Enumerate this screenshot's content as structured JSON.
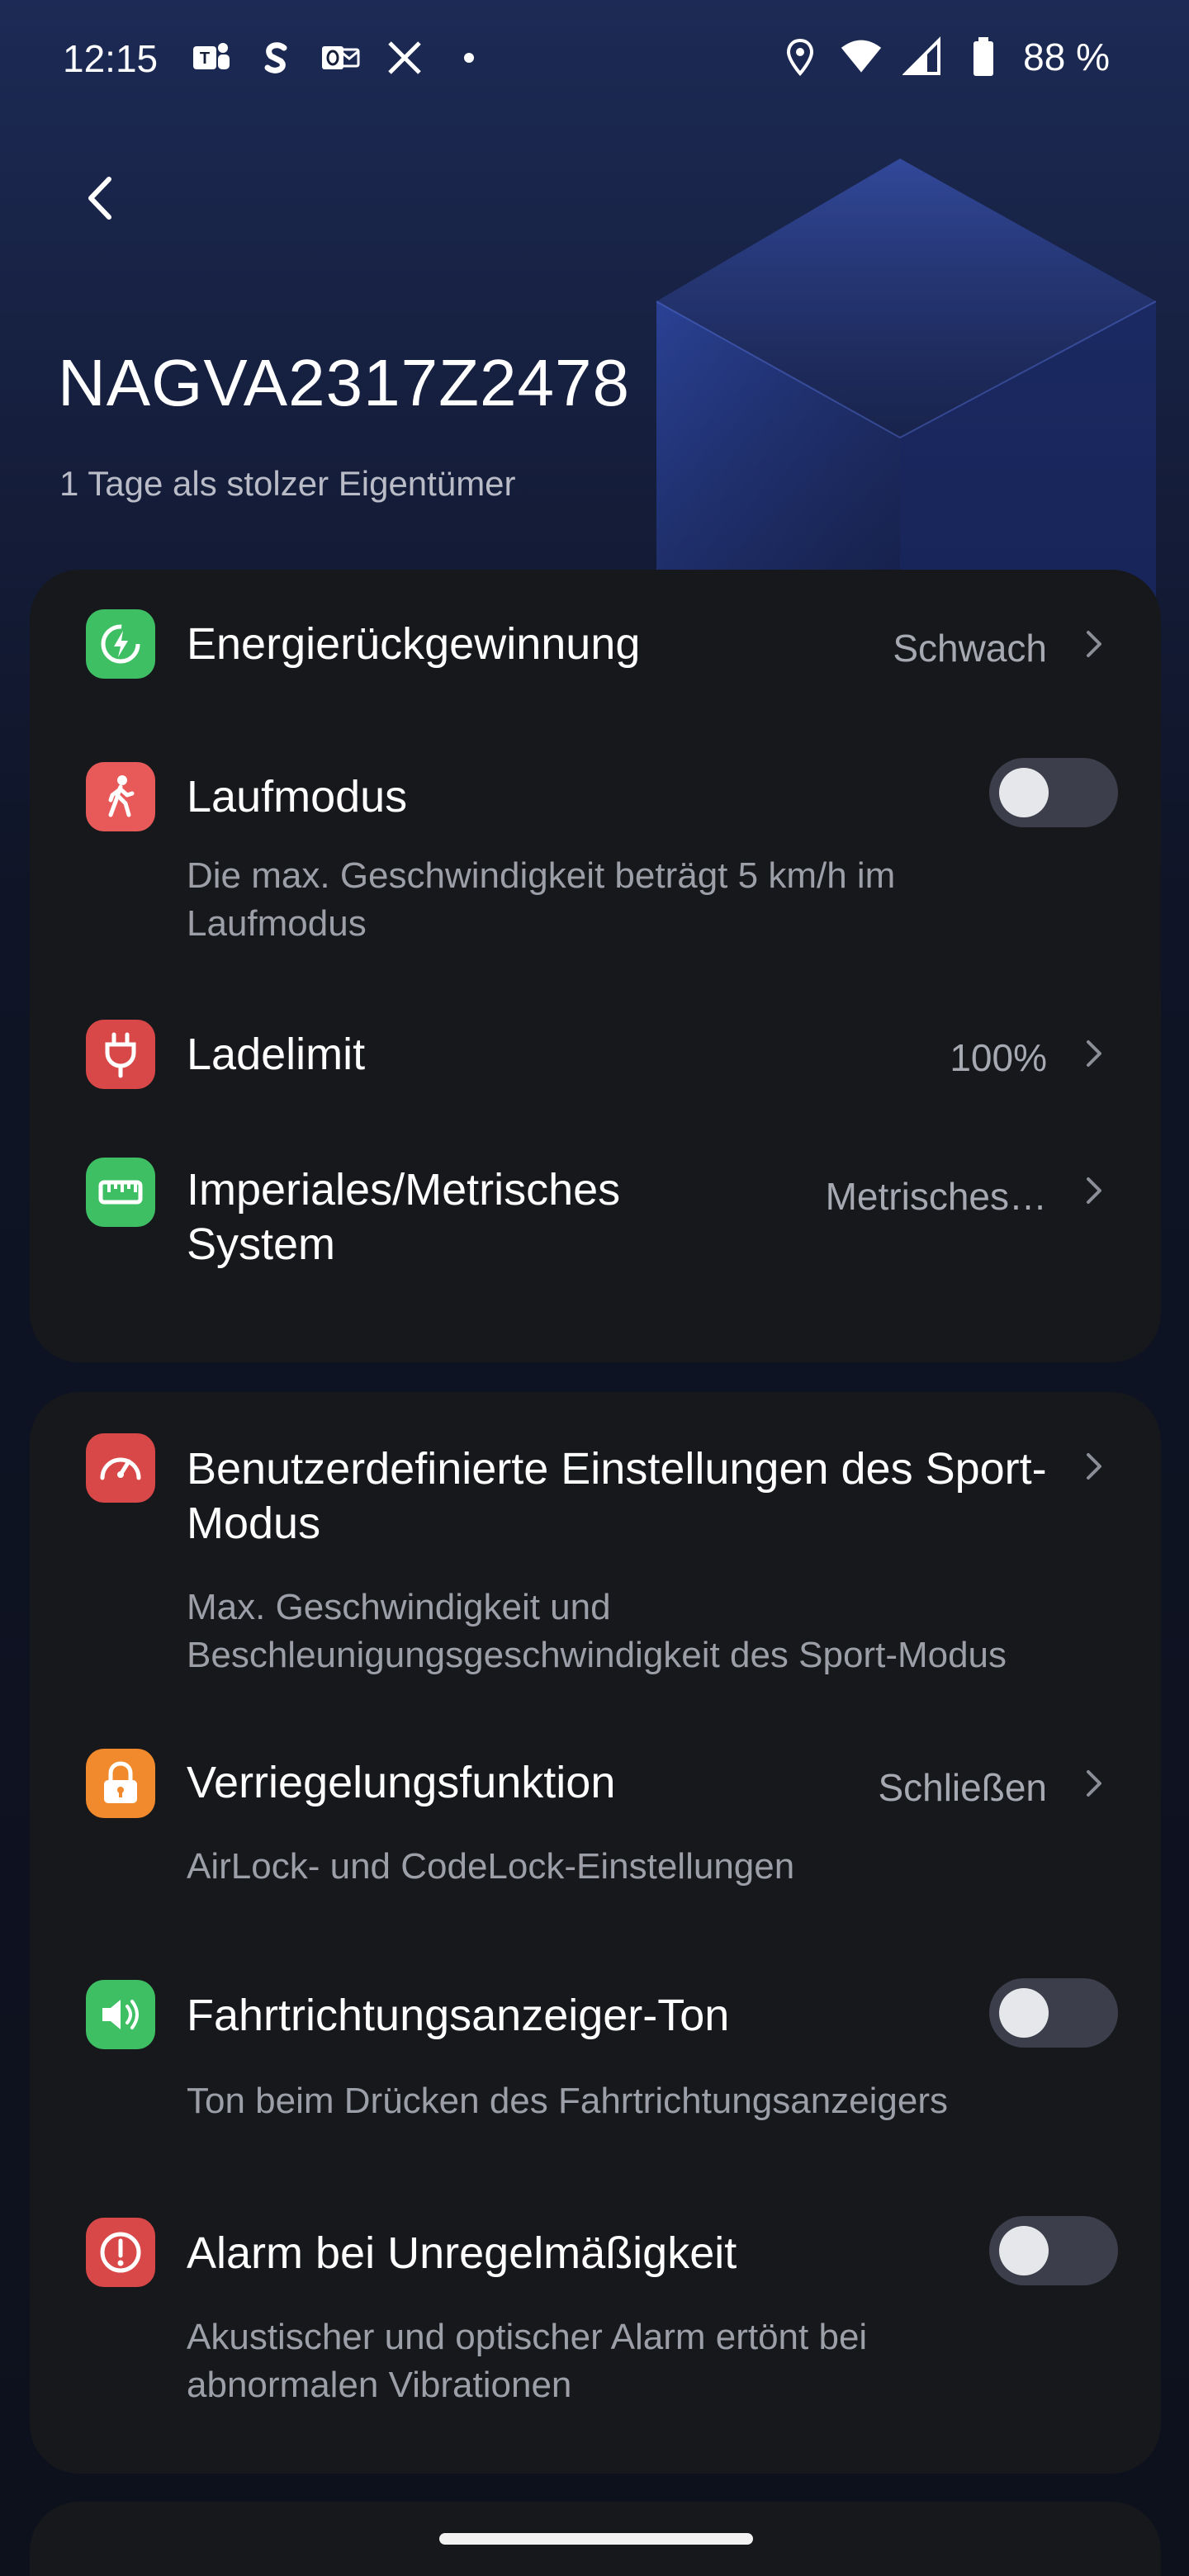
{
  "status_bar": {
    "time": "12:15",
    "left_icons": [
      "teams-icon",
      "shazam-icon",
      "outlook-icon",
      "x-icon",
      "dot-icon"
    ],
    "right_icons": [
      "location-icon",
      "wifi-icon",
      "signal-icon",
      "battery-icon"
    ],
    "battery": "88 %"
  },
  "header": {
    "title": "NAGVA2317Z2478",
    "subtitle": "1 Tage als stolzer Eigentümer"
  },
  "card1": {
    "energy": {
      "label": "Energierückgewinnung",
      "value": "Schwach",
      "icon": "energy-recovery-icon",
      "color": "#3fbf63"
    },
    "walk": {
      "label": "Laufmodus",
      "desc": "Die max. Geschwindigkeit beträgt 5 km/h im Laufmodus",
      "toggle_on": false,
      "icon": "walking-icon",
      "color": "#e85a5a"
    },
    "charge": {
      "label": "Ladelimit",
      "value": "100%",
      "icon": "plug-icon",
      "color": "#d94848"
    },
    "units": {
      "label": "Imperiales/Metrisches System",
      "value": "Metrisches…",
      "icon": "ruler-icon",
      "color": "#3fbf63"
    }
  },
  "card2": {
    "sport": {
      "label": "Benutzerdefinierte Einstellungen des Sport-Modus",
      "desc": "Max. Geschwindigkeit und Beschleunigungsgeschwindigkeit des Sport-Modus",
      "icon": "speedometer-icon",
      "color": "#d94848"
    },
    "lock": {
      "label": "Verriegelungsfunktion",
      "value": "Schließen",
      "desc": "AirLock- und CodeLock-Einstellungen",
      "icon": "lock-icon",
      "color": "#f08a2c"
    },
    "indicator": {
      "label": "Fahrtrichtungsanzeiger-Ton",
      "desc": "Ton beim Drücken des Fahrtrichtungsanzeigers",
      "toggle_on": false,
      "icon": "speaker-icon",
      "color": "#3fbf63"
    },
    "alarm": {
      "label": "Alarm bei Unregelmäßigkeit",
      "desc": "Akustischer und optischer Alarm ertönt bei abnormalen Vibrationen",
      "toggle_on": false,
      "icon": "alert-icon",
      "color": "#d94848"
    }
  }
}
